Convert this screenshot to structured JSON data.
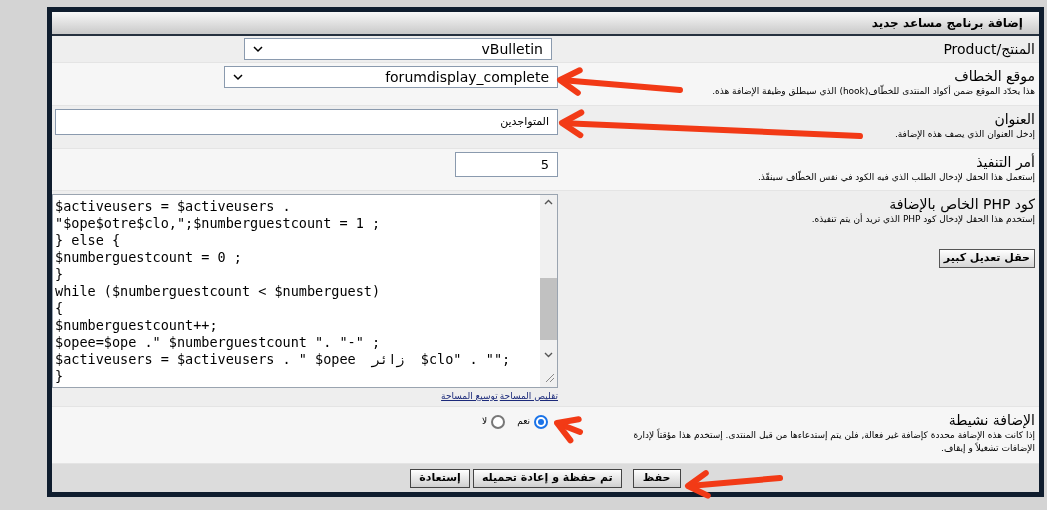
{
  "panel": {
    "title": "إضافة برنامج مساعد جديد"
  },
  "product": {
    "label": "المنتج/Product",
    "value": "vBulletin"
  },
  "hook": {
    "label": "موقع الخطاف",
    "help": "هذا يحدّد الموقع ضمن أكواد المنتدى للخطّاف(hook) الذي سيطلق وظيفة الإضافة هذه.",
    "value": "forumdisplay_complete"
  },
  "title_field": {
    "label": "العنوان",
    "help": "إدخل العنوان الذي يصف هذه الإضافة.",
    "value": "المتواجدين"
  },
  "order": {
    "label": "أمر التنفيذ",
    "help": "إستعمل هذا الحقل لإدخال الطلب الذي فيه الكود في نفس الخطّاف سينفّذ.",
    "value": "5"
  },
  "php_code": {
    "label": "كود PHP الخاص بالإضافة",
    "help": "إستخدم هذا الحقل لإدخال كود PHP الذي تريد أن يتم تنفيذه.",
    "large_edit_button": "حقل تعديل كبير",
    "lines": [
      "$activeusers = $activeusers .",
      "\"$ope$otre$clo,\";$numberguestcount = 1 ;",
      "} else {",
      "$numberguestcount = 0 ;",
      "}",
      "while ($numberguestcount < $numberguest)",
      "{",
      "$numberguestcount++;",
      "$opee=$ope .\" $numberguestcount \". \"-\" ;",
      "$activeusers = $activeusers . \" $opee  زائر  $clo\" . \"\";",
      "}"
    ],
    "links": [
      "تقليص المساحة",
      "توسيع المساحة"
    ]
  },
  "active": {
    "label": "الإضافة نشيطة",
    "help": "إذا كانت هذه الإضافة محددة كإضافة غير فعالة, فلن يتم إستدعاءها من قبل المنتدى. إستخدم هذا مؤقتاً لإدارة الإضافات تشغيلاً و إيقاف.",
    "options": [
      {
        "label": "نعم",
        "selected": true
      },
      {
        "label": "لا",
        "selected": false
      }
    ]
  },
  "buttons": [
    {
      "label": "حفظ"
    },
    {
      "label": "تم حفظة و إعادة تحميله"
    },
    {
      "label": "إستعادة"
    }
  ]
}
